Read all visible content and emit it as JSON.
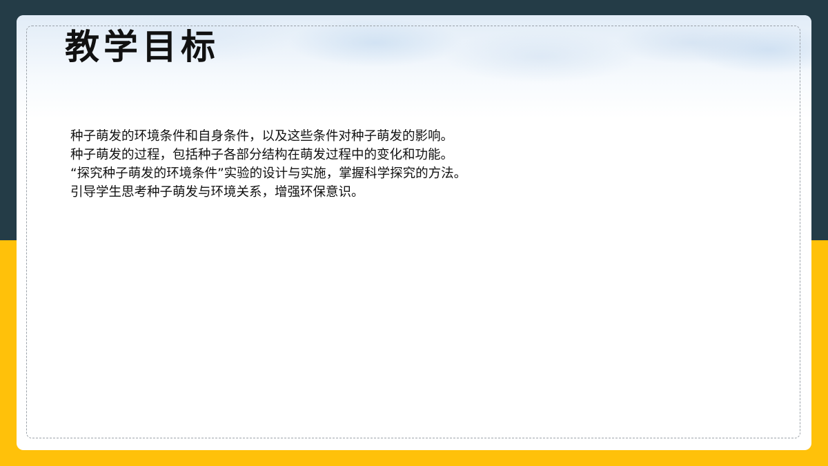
{
  "slide": {
    "title": "教学目标",
    "objectives": [
      "种子萌发的环境条件和自身条件，以及这些条件对种子萌发的影响。",
      "种子萌发的过程，包括种子各部分结构在萌发过程中的变化和功能。",
      "“探究种子萌发的环境条件”实验的设计与实施，掌握科学探究的方法。",
      "引导学生思考种子萌发与环境关系，增强环保意识。"
    ]
  },
  "colors": {
    "top_background": "#243c47",
    "bottom_background": "#ffc10a",
    "card": "#ffffff",
    "text": "#111111"
  }
}
